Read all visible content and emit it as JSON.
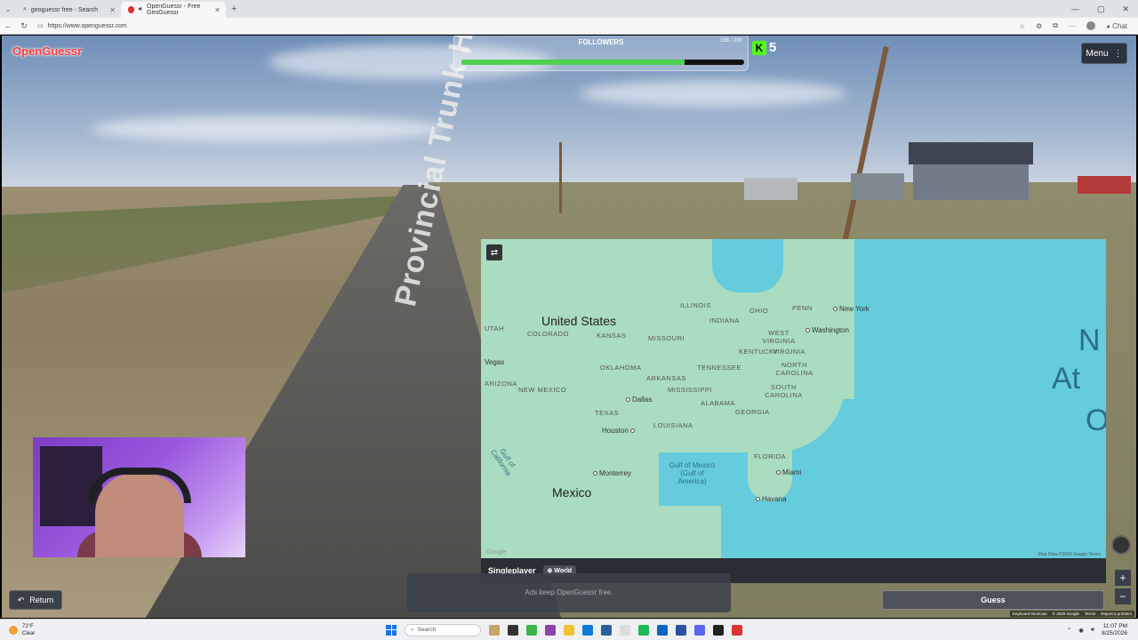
{
  "browser": {
    "tabs": [
      {
        "label": "geoguessr free - Search",
        "active": false
      },
      {
        "label": "OpenGuessr - Free GeoGuessr",
        "active": true
      }
    ],
    "url": "https://www.openguessr.com",
    "chat_label": "Chat"
  },
  "game": {
    "logo": "OpenGuessr",
    "menu_label": "Menu",
    "followers": {
      "title": "FOLLOWERS",
      "percent_label": "79%",
      "count_label": "158 / 200",
      "progress": 0.79
    },
    "kick_count": "5",
    "road_sign_text": "Provincial Trunk Hwy",
    "return_label": "Return",
    "guess_label": "Guess",
    "ad_text": "Ads keep OpenGuessr free.",
    "mode_label": "Singleplayer",
    "mode_chip": "World",
    "google_footer": [
      "Keyboard shortcuts",
      "© 2026 Google",
      "Terms",
      "Report a problem"
    ]
  },
  "map": {
    "countries": [
      "United States",
      "Mexico"
    ],
    "states": [
      "UTAH",
      "COLORADO",
      "KANSAS",
      "MISSOURI",
      "INDIANA",
      "OHIO",
      "PENN",
      "ILLINOIS",
      "WEST VIRGINIA",
      "KENTUCKY",
      "VIRGINIA",
      "OKLAHOMA",
      "TENNESSEE",
      "NORTH CAROLINA",
      "ARIZONA",
      "NEW MEXICO",
      "ARKANSAS",
      "MISSISSIPPI",
      "SOUTH CAROLINA",
      "ALABAMA",
      "GEORGIA",
      "TEXAS",
      "LOUISIANA",
      "FLORIDA"
    ],
    "cities": [
      "New York",
      "Washington",
      "Dallas",
      "Houston",
      "Monterrey",
      "Miami",
      "Havana",
      "Vegas"
    ],
    "gulf_label": "Gulf of Mexico (Gulf of America)",
    "gulf_of_california": "Gulf of California",
    "ocean_partial": [
      "N",
      "At",
      "O"
    ],
    "attribution": "Map Data ©2026 Google  Terms",
    "google_mark": "Google"
  },
  "taskbar": {
    "weather_temp": "72°F",
    "weather_desc": "Clear",
    "search_placeholder": "Search",
    "time": "11:07 PM",
    "date": "8/25/2026"
  }
}
